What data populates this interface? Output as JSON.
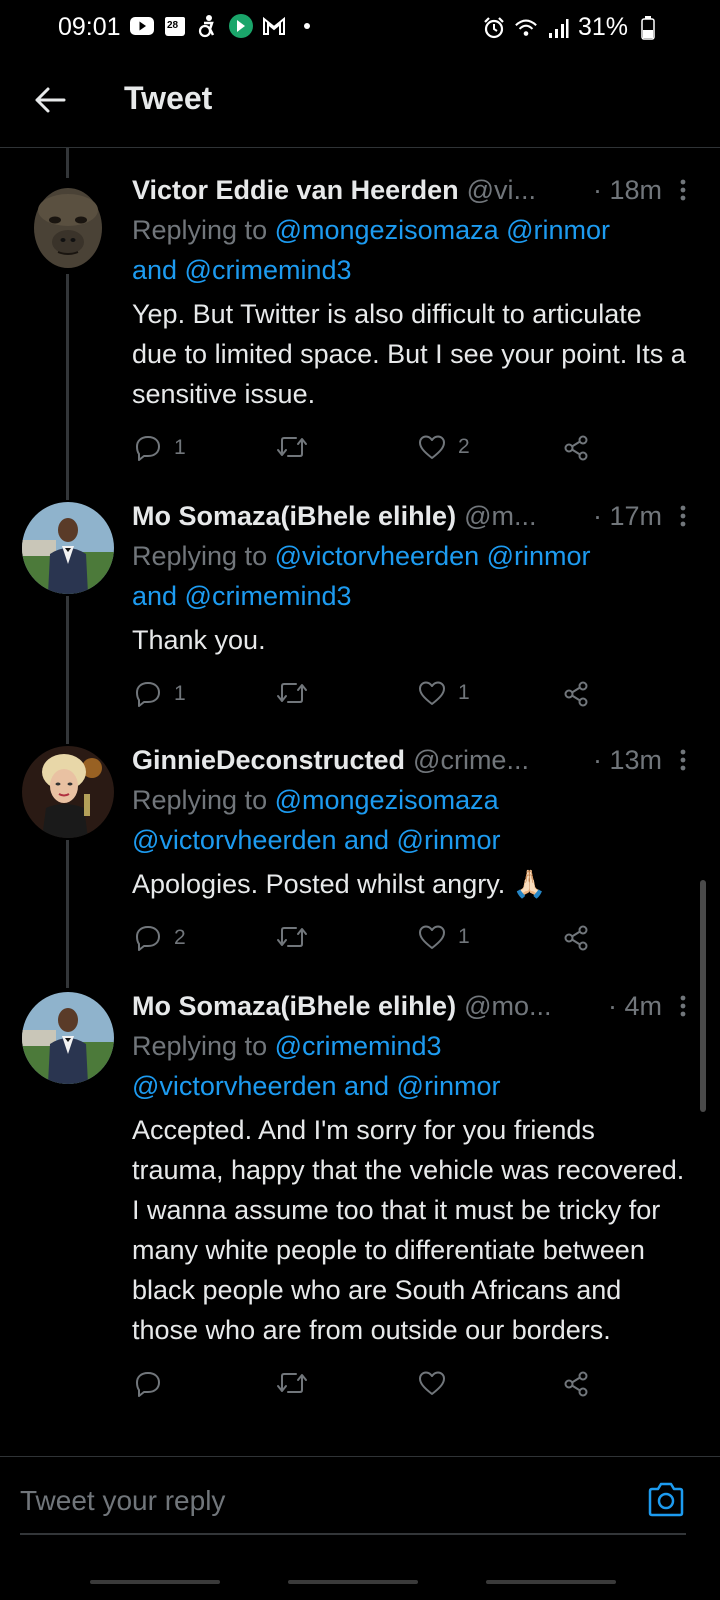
{
  "status_bar": {
    "time": "09:01",
    "battery": "31%",
    "icons": [
      "youtube-icon",
      "calendar-icon",
      "accessibility-icon",
      "app-icon",
      "gmail-icon",
      "dot-icon",
      "alarm-icon",
      "wifi-icon",
      "signal-icon",
      "battery-icon"
    ],
    "calendar_day": "28"
  },
  "header": {
    "title": "Tweet"
  },
  "tweets": [
    {
      "name": "Victor Eddie van Heerden",
      "handle": "@vi...",
      "time": "· 18m",
      "replying_prefix": "Replying to",
      "mentions_line1": "@mongezisomaza @rinmor",
      "mentions_line2": "and @crimemind3",
      "text": "Yep. But Twitter is also difficult to articulate due to limited space. But I see your point. Its a sensitive issue.",
      "replies": "1",
      "retweets": "",
      "likes": "2"
    },
    {
      "name": "Mo Somaza(iBhele elihle)",
      "handle": "@m...",
      "time": "· 17m",
      "replying_prefix": "Replying to",
      "mentions_line1": "@victorvheerden @rinmor",
      "mentions_line2": "and @crimemind3",
      "text": "Thank you.",
      "replies": "1",
      "retweets": "",
      "likes": "1"
    },
    {
      "name": "GinnieDeconstructed",
      "handle": "@crime...",
      "time": "· 13m",
      "replying_prefix": "Replying to",
      "mentions_line1": "@mongezisomaza",
      "mentions_line2": "@victorvheerden and @rinmor",
      "text": "Apologies. Posted whilst angry. 🙏🏻",
      "replies": "2",
      "retweets": "",
      "likes": "1"
    },
    {
      "name": "Mo Somaza(iBhele elihle)",
      "handle": "@mo...",
      "time": "· 4m",
      "replying_prefix": "Replying to",
      "mentions_line1": "@crimemind3",
      "mentions_line2": "@victorvheerden and @rinmor",
      "text": "Accepted. And I'm sorry for you friends trauma, happy that the vehicle was recovered. I wanna assume too that it must be tricky for many white people to differentiate between black people who are South Africans and those who are from outside our borders.",
      "replies": "",
      "retweets": "",
      "likes": ""
    }
  ],
  "reply_bar": {
    "placeholder": "Tweet your reply"
  },
  "colors": {
    "background": "#000000",
    "text": "#e7e9ea",
    "secondary": "#71767b",
    "accent": "#1d9bf0"
  }
}
